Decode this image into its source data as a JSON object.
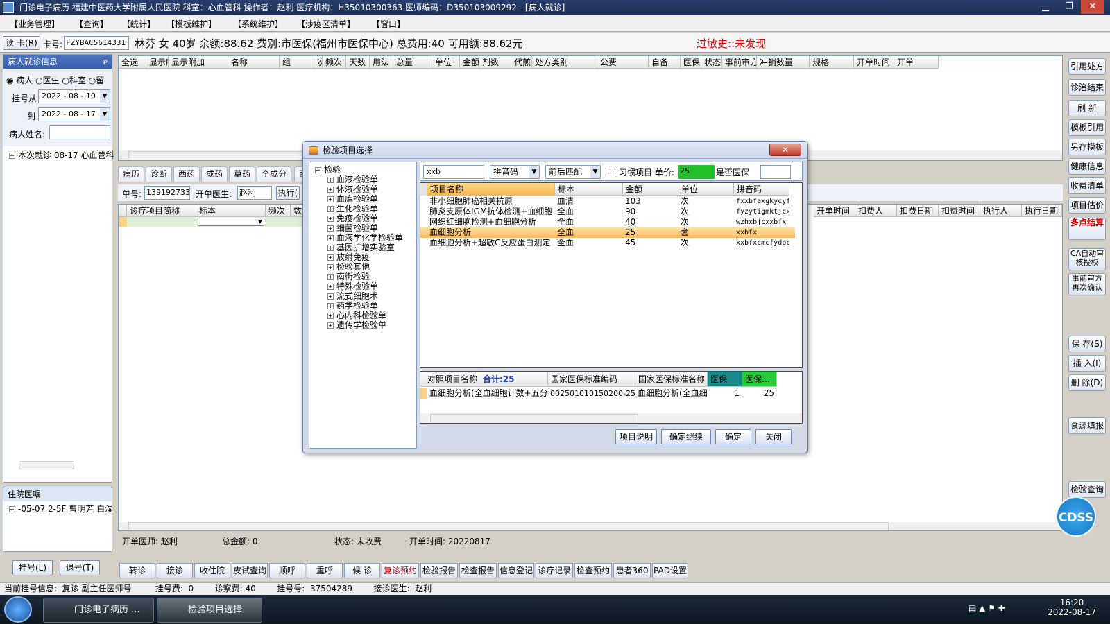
{
  "window": {
    "title": "门诊电子病历  福建中医药大学附属人民医院  科室：心血管科  操作者：赵利  医疗机构：H35010300363  医师编码：D350103009292 - [病人就诊]"
  },
  "menu": [
    "【业务管理】",
    "【查询】",
    "【统计】",
    "【模板维护】",
    "【系统维护】",
    "【涉疫区清单】",
    "【窗口】"
  ],
  "patient": {
    "read_card": "读 卡(R)",
    "card_label": "卡号:",
    "card_no": "FZYBAC5614331",
    "info": "林芬  女  40岁  余额:88.62  费别:市医保(福州市医保中心)  总费用:40  可用额:88.62元",
    "allergy": "过敏史::未发现"
  },
  "left": {
    "title": "病人就诊信息",
    "radio": [
      "病人",
      "医生",
      "科室",
      "留"
    ],
    "reg_from_label": "挂号从",
    "reg_from": "2022 - 08 - 10",
    "reg_to_label": "到",
    "reg_to": "2022 - 08 - 17",
    "name_label": "病人姓名:",
    "visit": "本次就诊 08-17 心血管科",
    "inpatient_title": "住院医嘱",
    "inpatient_item": "-05-07 2-5F 曹明芳 白湿",
    "btn_reg": "挂号(L)",
    "btn_unreg": "退号(T)"
  },
  "rx_headers": [
    "全选",
    "显示所有",
    "显示附加",
    "名称",
    "组",
    "次量",
    "频次",
    "天数",
    "用法",
    "总量",
    "单位",
    "金额",
    "剂数",
    "代煎方式",
    "处方类别",
    "公费",
    "自备",
    "医保",
    "状态",
    "事前审方状态",
    "冲销数量",
    "规格",
    "开单时间",
    "开单"
  ],
  "tabs": [
    "病历",
    "诊断",
    "西药",
    "成药",
    "草药",
    "全成分",
    "西"
  ],
  "order": {
    "no_label": "单号:",
    "no": "139192733",
    "doctor_label": "开单医生:",
    "doctor": "赵利",
    "exec": "执行(",
    "headers": [
      "诊疗项目简称",
      "标本",
      "频次",
      "数"
    ],
    "headers_right": [
      "开单时间",
      "扣费人",
      "扣费日期",
      "扣费时间",
      "执行人",
      "执行日期"
    ]
  },
  "bottom_info": {
    "doctor": "开单医师: 赵利",
    "total": "总金额: 0",
    "status": "状态: 未收费",
    "time": "开单时间: 20220817"
  },
  "bottom_buttons": [
    "转诊",
    "接诊",
    "收住院",
    "皮试查询",
    "顺呼",
    "重呼",
    "候 诊",
    "复诊预约",
    "检验报告",
    "检查报告",
    "信息登记",
    "诊疗记录",
    "检查预约",
    "患者360",
    "PAD设置"
  ],
  "right_buttons": [
    "引用处方",
    "诊治结束",
    "刷 新",
    "模板引用",
    "另存模板",
    "健康信息",
    "收费清单",
    "项目估价",
    "多点结算",
    "CA自动审核授权",
    "事前审方再次确认",
    "保 存(S)",
    "插 入(I)",
    "删 除(D)",
    "食源填报",
    "检验查询"
  ],
  "status": "当前挂号信息:  复诊 副主任医师号         挂号费:  0        诊察费: 40        挂号号:  37504289        接诊医生:  赵利",
  "dialog": {
    "title": "检验项目选择",
    "tree_root": "检验",
    "tree": [
      "血液检验单",
      "体液检验单",
      "血库检验单",
      "生化检验单",
      "免疫检验单",
      "细菌检验单",
      "血液学化学检验单",
      "基因扩增实验室",
      "放射免疫",
      "检验其他",
      "南街检验",
      "特殊检验单",
      "流式细胞术",
      "药学检验单",
      "心内科检验单",
      "遗传学检验单"
    ],
    "search_value": "xxb",
    "search_type": "拼音码",
    "match_type": "前后匹配",
    "habit": "习惯项目",
    "price_label": "单价:",
    "price": "25",
    "insurance_label": "是否医保",
    "headers": [
      "项目名称",
      "标本",
      "金额",
      "单位",
      "拼音码"
    ],
    "rows": [
      [
        "非小细胞肺癌相关抗原",
        "血清",
        "103",
        "次",
        "fxxbfaxgkycyf"
      ],
      [
        "肺炎支原体IGM抗体检测+血细胞",
        "全血",
        "90",
        "次",
        "fyzytigmktjcx"
      ],
      [
        "网织红细胞检测+血细胞分析",
        "全血",
        "40",
        "次",
        "wzhxbjcxxbfx"
      ],
      [
        "血细胞分析",
        "全血",
        "25",
        "套",
        "xxbfx"
      ],
      [
        "血细胞分析+超敏C反应蛋白测定",
        "全血",
        "45",
        "次",
        "xxbfxcmcfydbc"
      ]
    ],
    "sub_headers": [
      "对照项目名称",
      "国家医保标准编码",
      "国家医保标准名称",
      "医保",
      "医保…"
    ],
    "sum_label": "合计:25",
    "sub_row": [
      "血细胞分析(全血细胞计数+五分",
      "002501010150200-25010",
      "血细胞分析(全血细胞",
      "1",
      "25"
    ],
    "buttons": [
      "项目说明",
      "确定继续",
      "确定",
      "关闭"
    ]
  },
  "taskbar": {
    "task1": "门诊电子病历 ...",
    "task2": "检验项目选择",
    "time": "16:20",
    "date": "2022-08-17"
  },
  "cdss": "CDSS"
}
